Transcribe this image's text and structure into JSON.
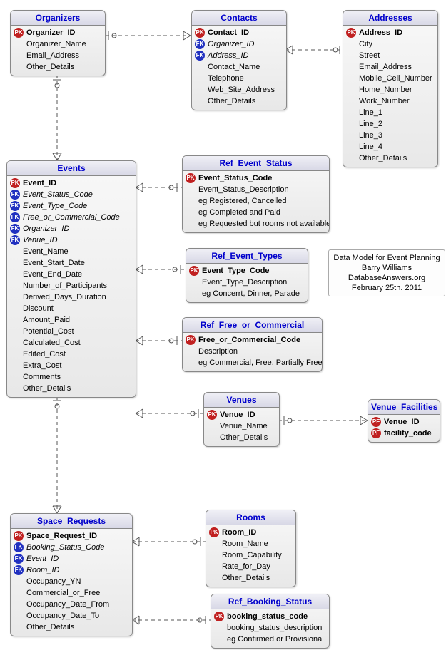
{
  "entities": {
    "organizers": {
      "title": "Organizers",
      "attrs": [
        {
          "key": "pk",
          "label": "Organizer_ID",
          "bold": true
        },
        {
          "key": "none",
          "label": "Organizer_Name"
        },
        {
          "key": "none",
          "label": "Email_Address"
        },
        {
          "key": "none",
          "label": "Other_Details"
        }
      ]
    },
    "contacts": {
      "title": "Contacts",
      "attrs": [
        {
          "key": "pk",
          "label": "Contact_ID",
          "bold": true
        },
        {
          "key": "fk",
          "label": "Organizer_ID",
          "italic": true
        },
        {
          "key": "fk",
          "label": "Address_ID",
          "italic": true
        },
        {
          "key": "none",
          "label": "Contact_Name"
        },
        {
          "key": "none",
          "label": "Telephone"
        },
        {
          "key": "none",
          "label": "Web_Site_Address"
        },
        {
          "key": "none",
          "label": "Other_Details"
        }
      ]
    },
    "addresses": {
      "title": "Addresses",
      "attrs": [
        {
          "key": "pk",
          "label": "Address_ID",
          "bold": true
        },
        {
          "key": "none",
          "label": "City"
        },
        {
          "key": "none",
          "label": "Street"
        },
        {
          "key": "none",
          "label": "Email_Address"
        },
        {
          "key": "none",
          "label": "Mobile_Cell_Number"
        },
        {
          "key": "none",
          "label": "Home_Number"
        },
        {
          "key": "none",
          "label": "Work_Number"
        },
        {
          "key": "none",
          "label": "Line_1"
        },
        {
          "key": "none",
          "label": "Line_2"
        },
        {
          "key": "none",
          "label": "Line_3"
        },
        {
          "key": "none",
          "label": "Line_4"
        },
        {
          "key": "none",
          "label": "Other_Details"
        }
      ]
    },
    "events": {
      "title": "Events",
      "attrs": [
        {
          "key": "pk",
          "label": "Event_ID",
          "bold": true
        },
        {
          "key": "fk",
          "label": "Event_Status_Code",
          "italic": true
        },
        {
          "key": "fk",
          "label": "Event_Type_Code",
          "italic": true
        },
        {
          "key": "fk",
          "label": "Free_or_Commercial_Code",
          "italic": true
        },
        {
          "key": "fk",
          "label": "Organizer_ID",
          "italic": true
        },
        {
          "key": "fk",
          "label": "Venue_ID",
          "italic": true
        },
        {
          "key": "none",
          "label": "Event_Name"
        },
        {
          "key": "none",
          "label": "Event_Start_Date"
        },
        {
          "key": "none",
          "label": "Event_End_Date"
        },
        {
          "key": "none",
          "label": "Number_of_Participants"
        },
        {
          "key": "none",
          "label": "Derived_Days_Duration"
        },
        {
          "key": "none",
          "label": "Discount"
        },
        {
          "key": "none",
          "label": "Amount_Paid"
        },
        {
          "key": "none",
          "label": "Potential_Cost"
        },
        {
          "key": "none",
          "label": "Calculated_Cost"
        },
        {
          "key": "none",
          "label": "Edited_Cost"
        },
        {
          "key": "none",
          "label": "Extra_Cost"
        },
        {
          "key": "none",
          "label": "Comments"
        },
        {
          "key": "none",
          "label": "Other_Details"
        }
      ]
    },
    "ref_event_status": {
      "title": "Ref_Event_Status",
      "attrs": [
        {
          "key": "pk",
          "label": "Event_Status_Code",
          "bold": true
        },
        {
          "key": "none",
          "label": "Event_Status_Description"
        },
        {
          "key": "none",
          "label": "eg Registered, Cancelled"
        },
        {
          "key": "none",
          "label": "eg Completed and Paid"
        },
        {
          "key": "none",
          "label": "eg Requested but rooms not available"
        }
      ]
    },
    "ref_event_types": {
      "title": "Ref_Event_Types",
      "attrs": [
        {
          "key": "pk",
          "label": "Event_Type_Code",
          "bold": true
        },
        {
          "key": "none",
          "label": "Event_Type_Description"
        },
        {
          "key": "none",
          "label": "eg Concerrt, Dinner, Parade"
        }
      ]
    },
    "ref_free_or_commercial": {
      "title": "Ref_Free_or_Commercial",
      "attrs": [
        {
          "key": "pk",
          "label": "Free_or_Commercial_Code",
          "bold": true
        },
        {
          "key": "none",
          "label": "Description"
        },
        {
          "key": "none",
          "label": "eg Commercial, Free, Partially Free"
        }
      ]
    },
    "venues": {
      "title": "Venues",
      "attrs": [
        {
          "key": "pk",
          "label": "Venue_ID",
          "bold": true
        },
        {
          "key": "none",
          "label": "Venue_Name"
        },
        {
          "key": "none",
          "label": "Other_Details"
        }
      ]
    },
    "venue_facilities": {
      "title": "Venue_Facilities",
      "attrs": [
        {
          "key": "pf",
          "label": "Venue_ID",
          "bold": true
        },
        {
          "key": "pf",
          "label": "facility_code",
          "bold": true
        }
      ]
    },
    "space_requests": {
      "title": "Space_Requests",
      "attrs": [
        {
          "key": "pk",
          "label": "Space_Request_ID",
          "bold": true
        },
        {
          "key": "fk",
          "label": "Booking_Status_Code",
          "italic": true
        },
        {
          "key": "fk",
          "label": "Event_ID",
          "italic": true
        },
        {
          "key": "fk",
          "label": "Room_ID",
          "italic": true
        },
        {
          "key": "none",
          "label": "Occupancy_YN"
        },
        {
          "key": "none",
          "label": "Commercial_or_Free"
        },
        {
          "key": "none",
          "label": "Occupancy_Date_From"
        },
        {
          "key": "none",
          "label": "Occupancy_Date_To"
        },
        {
          "key": "none",
          "label": "Other_Details"
        }
      ]
    },
    "rooms": {
      "title": "Rooms",
      "attrs": [
        {
          "key": "pk",
          "label": "Room_ID",
          "bold": true
        },
        {
          "key": "none",
          "label": "Room_Name"
        },
        {
          "key": "none",
          "label": "Room_Capability"
        },
        {
          "key": "none",
          "label": "Rate_for_Day"
        },
        {
          "key": "none",
          "label": "Other_Details"
        }
      ]
    },
    "ref_booking_status": {
      "title": "Ref_Booking_Status",
      "attrs": [
        {
          "key": "pk",
          "label": "booking_status_code",
          "bold": true
        },
        {
          "key": "none",
          "label": "booking_status_description"
        },
        {
          "key": "none",
          "label": "eg Confirmed or Provisional"
        }
      ]
    }
  },
  "note": {
    "line1": "Data Model for Event Planning",
    "line2": "Barry Williams",
    "line3": "DatabaseAnswers.org",
    "line4": "February 25th.  2011"
  },
  "key_labels": {
    "pk": "PK",
    "fk": "FK",
    "pf": "PF"
  }
}
